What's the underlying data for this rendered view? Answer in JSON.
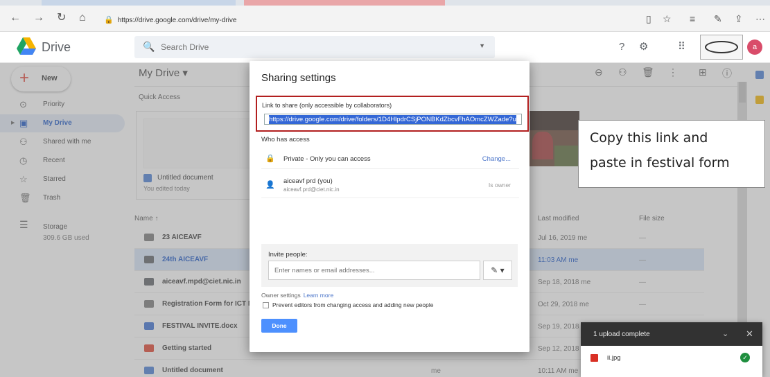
{
  "browser": {
    "url": "https://drive.google.com/drive/my-drive"
  },
  "header": {
    "app_name": "Drive",
    "search_placeholder": "Search Drive",
    "avatar_letter": "a"
  },
  "sidebar": {
    "new_label": "New",
    "items": [
      {
        "label": "Priority",
        "icon": "check-circle-icon"
      },
      {
        "label": "My Drive",
        "icon": "drive-icon"
      },
      {
        "label": "Shared with me",
        "icon": "people-icon"
      },
      {
        "label": "Recent",
        "icon": "clock-icon"
      },
      {
        "label": "Starred",
        "icon": "star-icon"
      },
      {
        "label": "Trash",
        "icon": "trash-icon"
      }
    ],
    "storage_label": "Storage",
    "storage_used": "309.6 GB used"
  },
  "main": {
    "title": "My Drive",
    "quick_access_label": "Quick Access",
    "quick_card": {
      "title": "Untitled document",
      "subtitle": "You edited today"
    },
    "columns": {
      "name": "Name",
      "last_modified": "Last modified",
      "file_size": "File size"
    },
    "rows": [
      {
        "name": "23 AICEAVF",
        "owner": "",
        "modified": "Jul 16, 2019 me",
        "size": "—",
        "type": "shared-folder"
      },
      {
        "name": "24th AICEAVF",
        "owner": "",
        "modified": "11:03 AM me",
        "size": "—",
        "type": "folder",
        "selected": true
      },
      {
        "name": "aiceavf.mpd@ciet.nic.in",
        "owner": "",
        "modified": "Sep 18, 2018 me",
        "size": "—",
        "type": "folder"
      },
      {
        "name": "Registration Form for ICT Mel",
        "owner": "",
        "modified": "Oct 29, 2018 me",
        "size": "—",
        "type": "shared-folder"
      },
      {
        "name": "FESTIVAL INVITE.docx",
        "owner": "",
        "modified": "Sep 19, 2018 n",
        "size": "",
        "type": "word"
      },
      {
        "name": "Getting started",
        "owner": "me",
        "modified": "Sep 12, 2018 n",
        "size": "",
        "type": "pdf"
      },
      {
        "name": "Untitled document",
        "owner": "me",
        "modified": "10:11 AM me",
        "size": "—",
        "type": "doc"
      }
    ]
  },
  "dialog": {
    "title": "Sharing settings",
    "link_label": "Link to share (only accessible by collaborators)",
    "link_url": "https://drive.google.com/drive/folders/1D4HlpdrCSjPONBKdZbcvFhAOmcZWZade?u",
    "who_has_access": "Who has access",
    "access_rows": [
      {
        "text": "Private - Only you can access",
        "sub": "",
        "action": "Change..."
      },
      {
        "text": "aiceavf prd (you)",
        "sub": "aiceavf.prd@ciet.nic.in",
        "action": "Is owner"
      }
    ],
    "invite_label": "Invite people:",
    "invite_placeholder": "Enter names or email addresses...",
    "owner_settings": "Owner settings",
    "learn_more": "Learn more",
    "prevent_label": "Prevent editors from changing access and adding new people",
    "done_label": "Done"
  },
  "callout": {
    "line1": "Copy this link and",
    "line2": "paste in festival form"
  },
  "toast": {
    "title": "1 upload complete",
    "file": "ii.jpg"
  },
  "colors": {
    "accent": "#4d90fe",
    "highlight_border": "#b21f1f",
    "selected_row": "#d7e5fa"
  }
}
